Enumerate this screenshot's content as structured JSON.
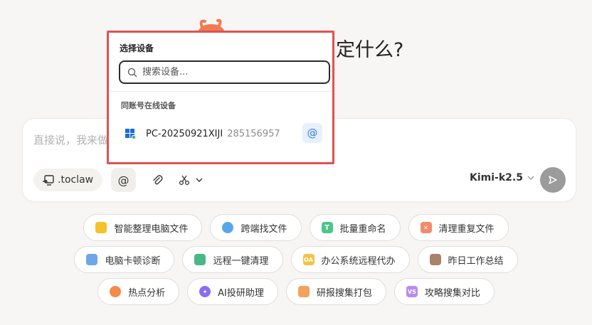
{
  "heading": {
    "visible_text": "定什么?"
  },
  "composer": {
    "placeholder_text": "直接说，我来做",
    "toclaw_label": ".toclaw",
    "at_label": "@",
    "model_label": "Kimi-k2.5"
  },
  "popover": {
    "title": "选择设备",
    "search_placeholder": "搜索设备...",
    "section_label": "同账号在线设备",
    "device": {
      "name": "PC-20250921XIJI",
      "id": "285156957",
      "at_label": "@"
    }
  },
  "chips": {
    "row1": [
      {
        "label": "智能整理电脑文件",
        "icon": "folder-icon",
        "color": "#f5c22c"
      },
      {
        "label": "跨端找文件",
        "icon": "search-icon",
        "color": "#5aa7e8"
      },
      {
        "label": "批量重命名",
        "icon": "t-icon",
        "color": "#4cc785"
      },
      {
        "label": "清理重复文件",
        "icon": "clean-icon",
        "color": "#f08c6c"
      }
    ],
    "row2": [
      {
        "label": "电脑卡顿诊断",
        "icon": "monitor-icon",
        "color": "#6ea6ea"
      },
      {
        "label": "远程一键清理",
        "icon": "broom-icon",
        "color": "#49b884"
      },
      {
        "label": "办公系统远程代办",
        "icon": "oa-icon",
        "color": "#f6c244",
        "text": "OA"
      },
      {
        "label": "昨日工作总结",
        "icon": "bag-icon",
        "color": "#a8826b"
      }
    ],
    "row3": [
      {
        "label": "热点分析",
        "icon": "flame-icon",
        "color": "#f38a4a"
      },
      {
        "label": "AI投研助理",
        "icon": "sparkle-icon",
        "color": "#8b6cf0"
      },
      {
        "label": "研报搜集打包",
        "icon": "box-icon",
        "color": "#f3a15f"
      },
      {
        "label": "攻略搜集对比",
        "icon": "vs-icon",
        "color": "#b98bf2",
        "text": "VS"
      }
    ]
  },
  "colors": {
    "accent_red": "#e05252",
    "send_gray": "#9b9b9b",
    "at_blue": "#2f7ee6"
  }
}
